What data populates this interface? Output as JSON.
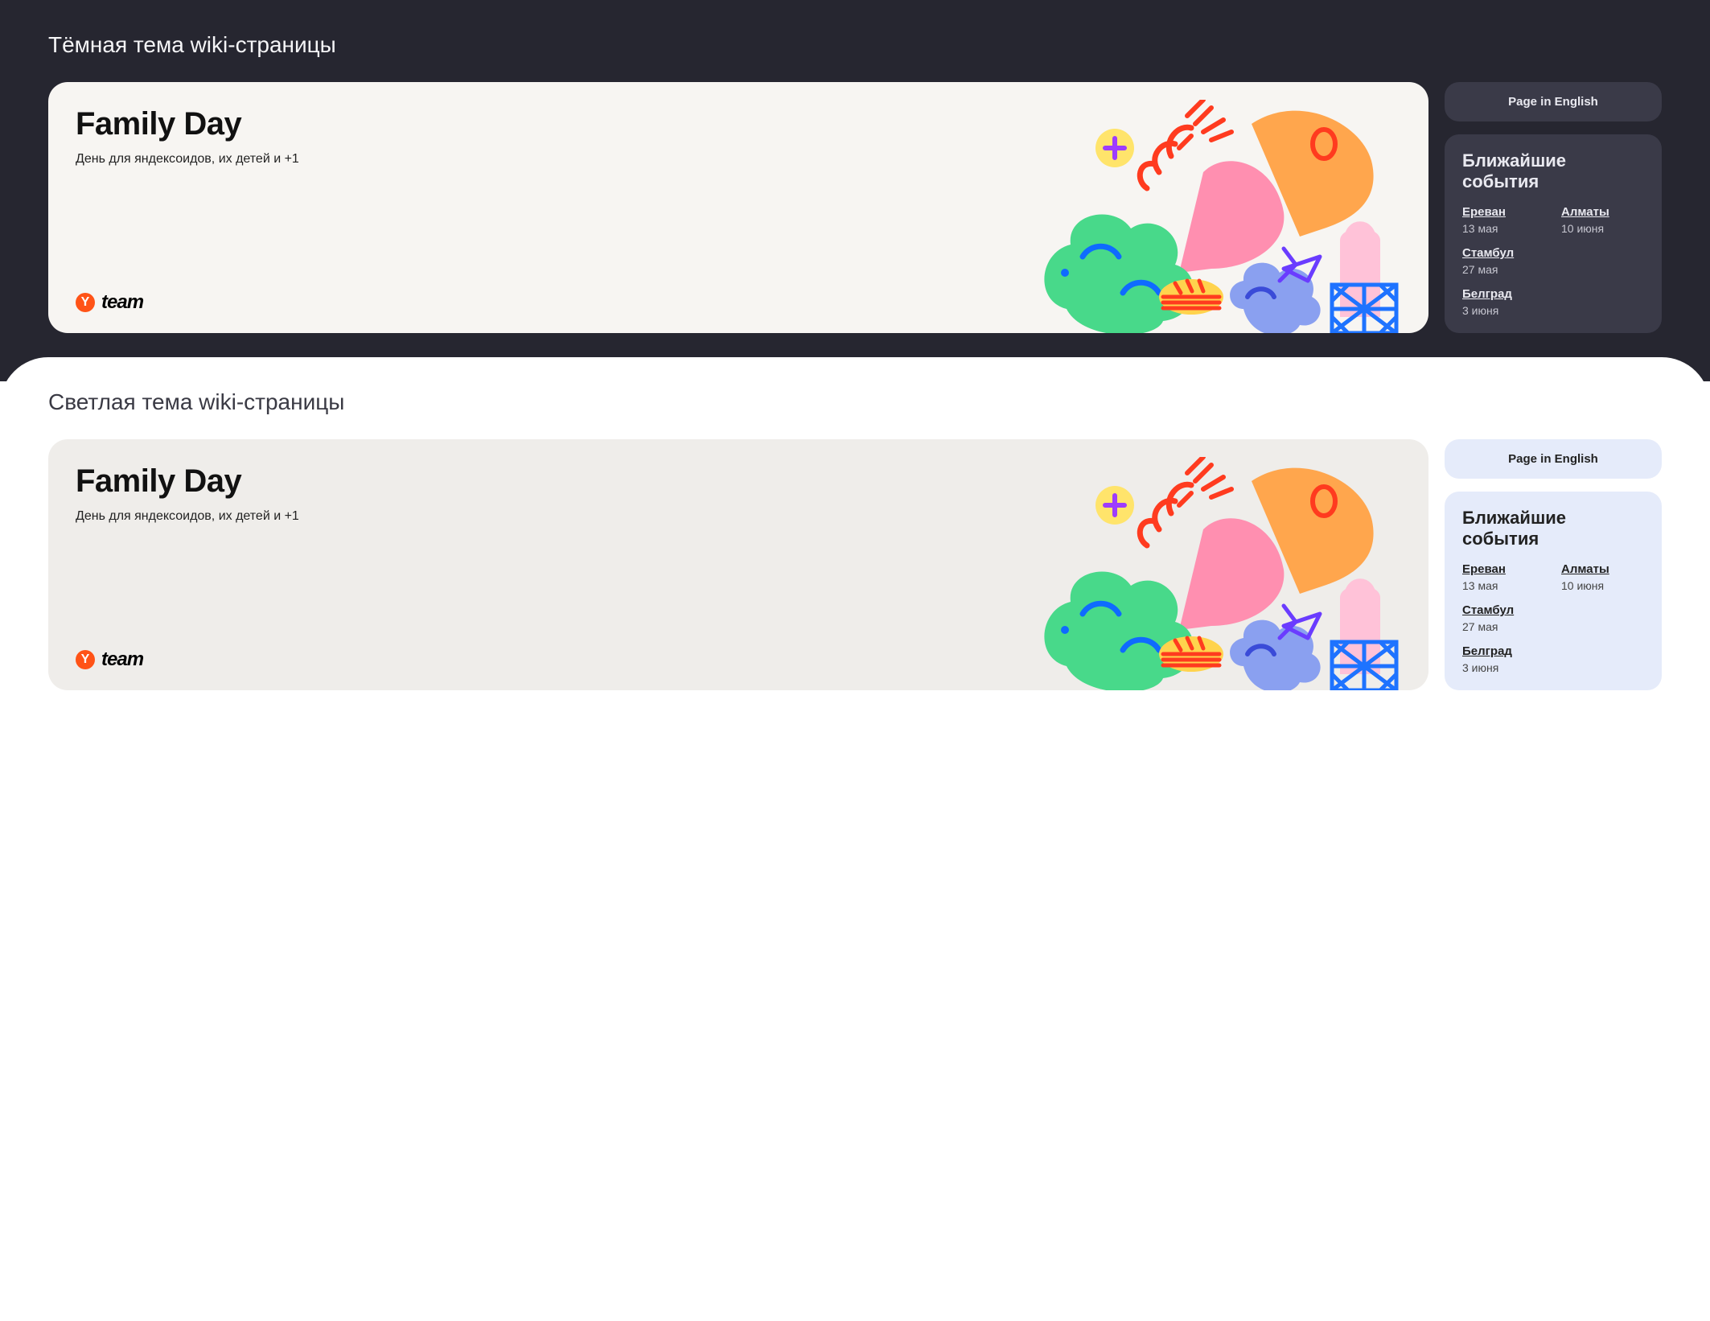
{
  "sections": {
    "dark_title": "Тёмная тема wiki-страницы",
    "light_title": "Светлая тема wiki-страницы"
  },
  "hero": {
    "title": "Family Day",
    "subtitle": "День для яндексоидов, их детей и +1",
    "logo_letter": "Y",
    "logo_text": "team"
  },
  "sidebar": {
    "lang_button": "Page in English",
    "events_title": "Ближайшие события",
    "events": [
      {
        "city": "Ереван",
        "date": "13 мая"
      },
      {
        "city": "Алматы",
        "date": "10 июня"
      },
      {
        "city": "Стамбул",
        "date": "27 мая"
      },
      {
        "city": "Белград",
        "date": "3 июня"
      }
    ]
  },
  "colors": {
    "dark_bg": "#262630",
    "card_dark_panel": "#3a3a48",
    "card_light_panel": "#e5ebfa",
    "hero_card_dark": "#f7f5f2",
    "hero_card_light": "#efedea",
    "accent_orange": "#ff5317"
  }
}
